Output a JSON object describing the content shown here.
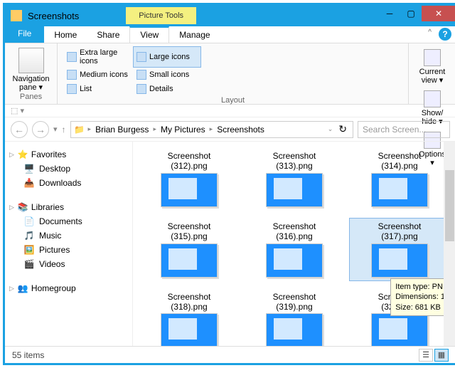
{
  "titlebar": {
    "title": "Screenshots",
    "tools": "Picture Tools"
  },
  "tabs": {
    "file": "File",
    "items": [
      "Home",
      "Share",
      "View",
      "Manage"
    ],
    "active": 2
  },
  "ribbon": {
    "nav": "Navigation\npane ▾",
    "panes_lbl": "Panes",
    "layout_lbl": "Layout",
    "layouts": [
      [
        "Extra large icons",
        "Large icons"
      ],
      [
        "Medium icons",
        "Small icons"
      ],
      [
        "List",
        "Details"
      ]
    ],
    "layout_selected": "Large icons",
    "current": "Current\nview ▾",
    "showhide": "Show/\nhide ▾",
    "options": "Options\n▾"
  },
  "breadcrumbs": [
    "Brian Burgess",
    "My Pictures",
    "Screenshots"
  ],
  "search_placeholder": "Search Screen...",
  "sidebar": {
    "favorites": {
      "label": "Favorites",
      "items": [
        "Desktop",
        "Downloads"
      ]
    },
    "libraries": {
      "label": "Libraries",
      "items": [
        "Documents",
        "Music",
        "Pictures",
        "Videos"
      ]
    },
    "homegroup": {
      "label": "Homegroup"
    }
  },
  "files": [
    {
      "name": "Screenshot (312).png"
    },
    {
      "name": "Screenshot (313).png"
    },
    {
      "name": "Screenshot (314).png"
    },
    {
      "name": "Screenshot (315).png"
    },
    {
      "name": "Screenshot (316).png"
    },
    {
      "name": "Screenshot (317).png",
      "selected": true
    },
    {
      "name": "Screenshot (318).png"
    },
    {
      "name": "Screenshot (319).png"
    },
    {
      "name": "Screenshot (320).png"
    }
  ],
  "tooltip": {
    "type": "Item type: PN",
    "dim": "Dimensions: 1",
    "size": "Size: 681 KB"
  },
  "status": {
    "count": "55 items"
  }
}
